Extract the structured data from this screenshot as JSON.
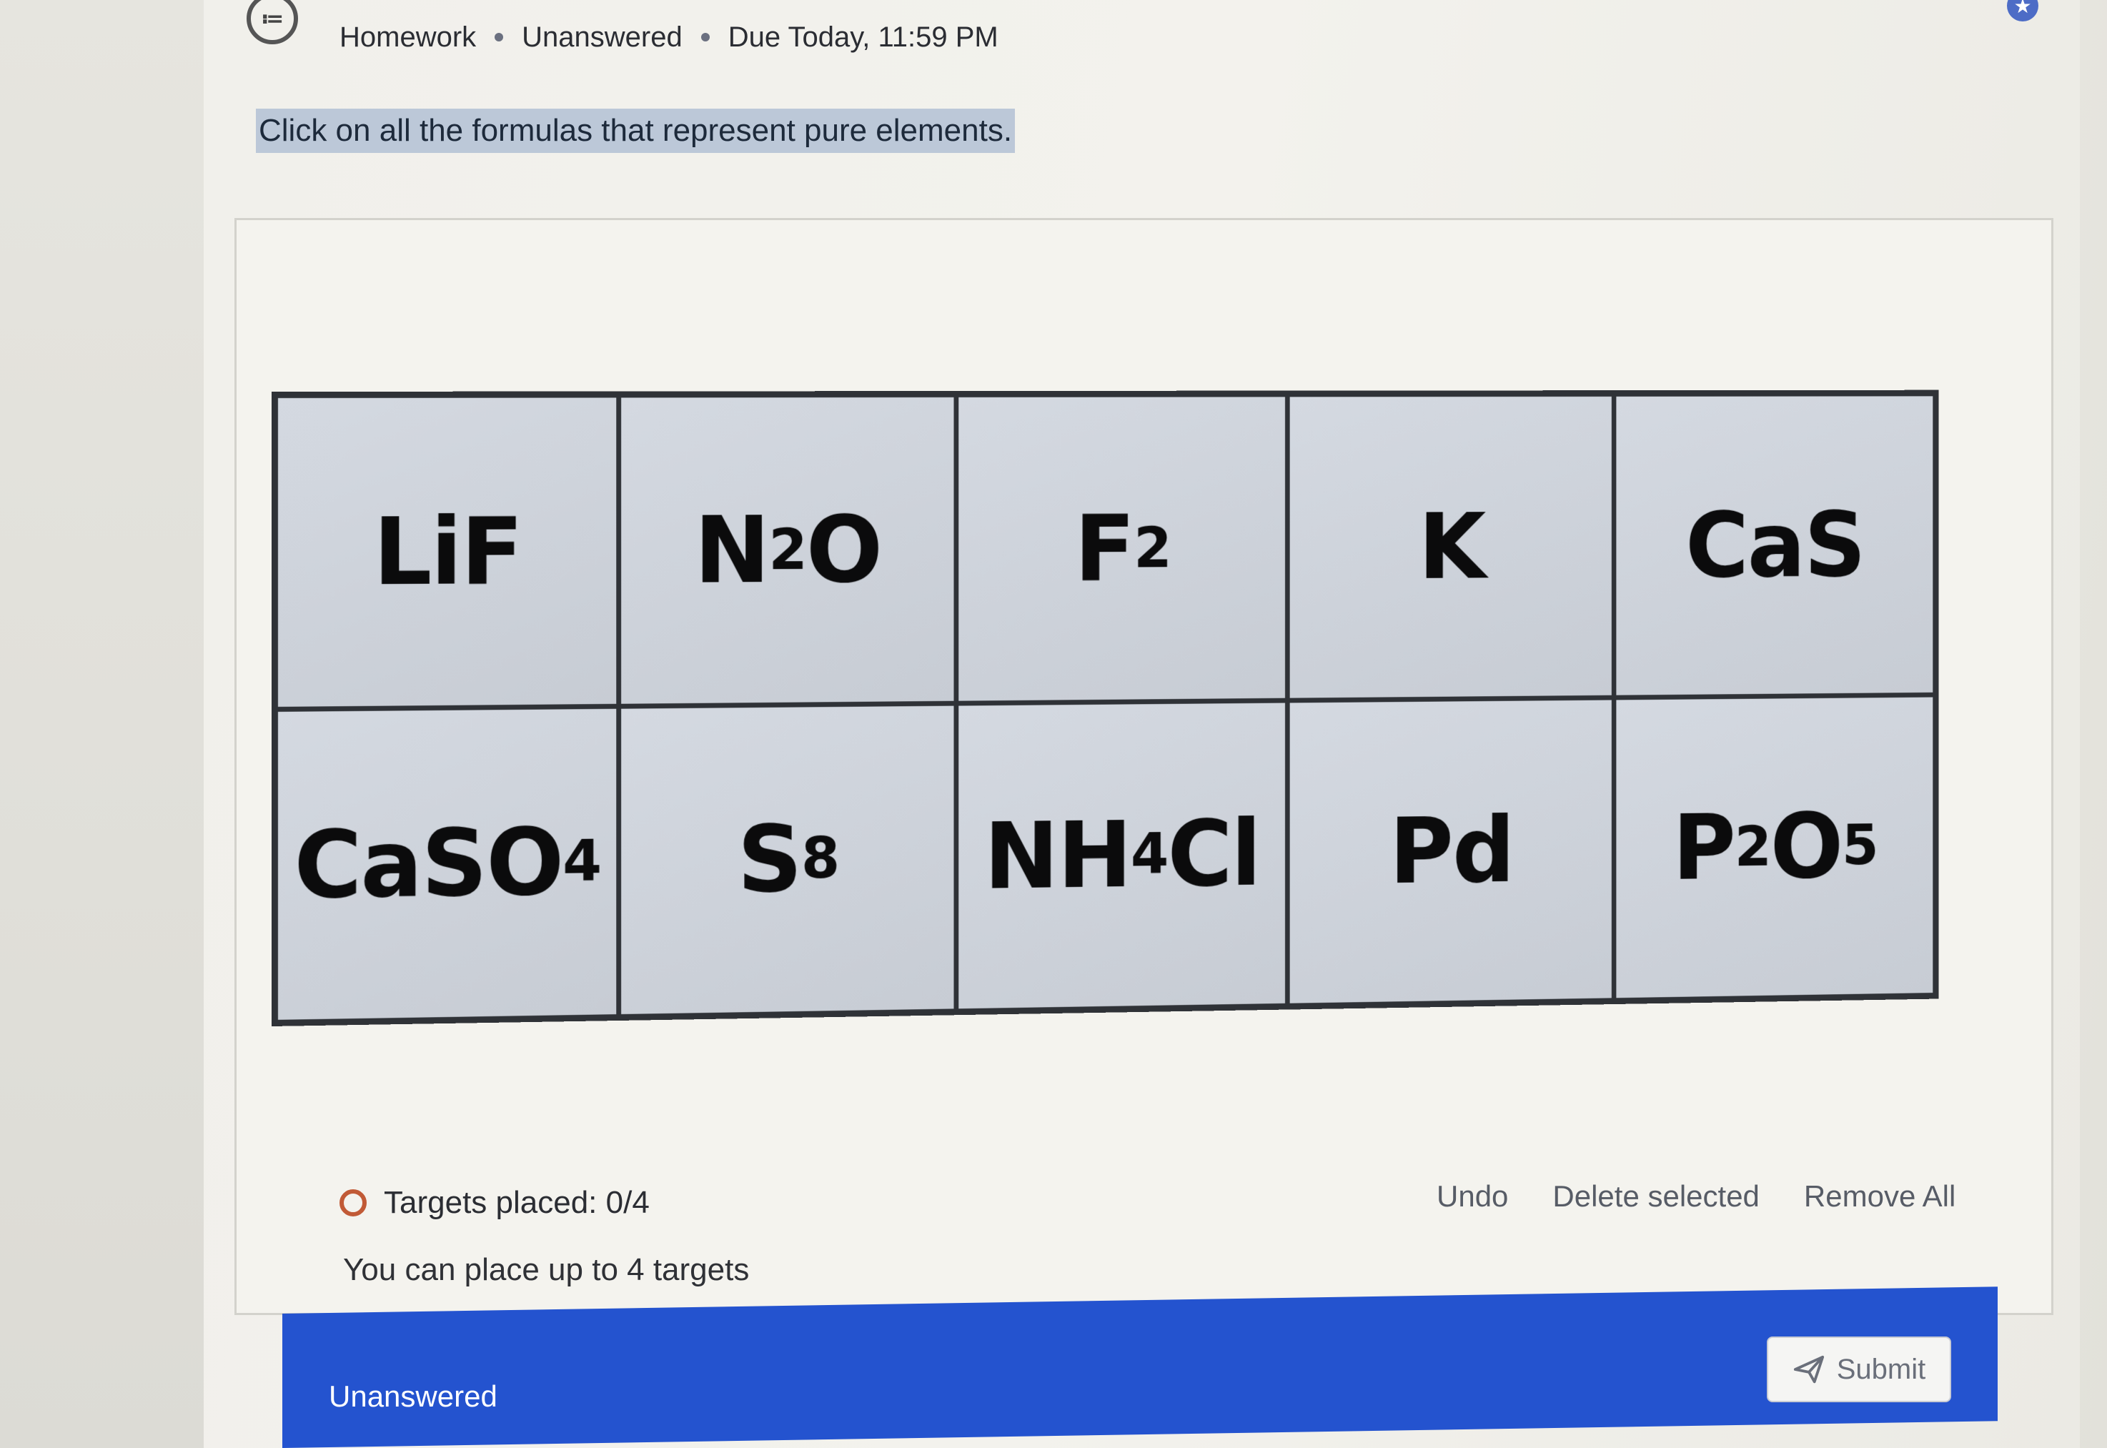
{
  "header": {
    "crumb_1": "Homework",
    "crumb_2": "Unanswered",
    "crumb_3": "Due Today, 11:59 PM"
  },
  "icons": {
    "question_list": "question-list-icon",
    "star": "star-badge-icon",
    "send": "send-icon"
  },
  "question": {
    "prompt": "Click on all the formulas that represent pure elements."
  },
  "grid": {
    "cells": [
      {
        "base": "LiF"
      },
      {
        "parts": [
          "N",
          "2",
          "O",
          ""
        ]
      },
      {
        "parts": [
          "F",
          "2",
          "",
          ""
        ]
      },
      {
        "base": "K"
      },
      {
        "base": "CaS"
      },
      {
        "parts": [
          "CaSO",
          "4",
          "",
          ""
        ]
      },
      {
        "parts": [
          "S",
          "8",
          "",
          ""
        ]
      },
      {
        "parts": [
          "NH",
          "4",
          "Cl",
          ""
        ]
      },
      {
        "base": "Pd"
      },
      {
        "parts": [
          "P",
          "2",
          "O",
          "5"
        ]
      }
    ]
  },
  "status": {
    "targets_label": "Targets placed: 0/4",
    "hint": "You can place up to 4 targets"
  },
  "tools": {
    "undo": "Undo",
    "delete_selected": "Delete selected",
    "remove_all": "Remove All"
  },
  "footer": {
    "status": "Unanswered",
    "submit": "Submit"
  },
  "colors": {
    "accent": "#2453cf",
    "highlight": "#bcc8d8",
    "status_ring": "#c15a36"
  }
}
